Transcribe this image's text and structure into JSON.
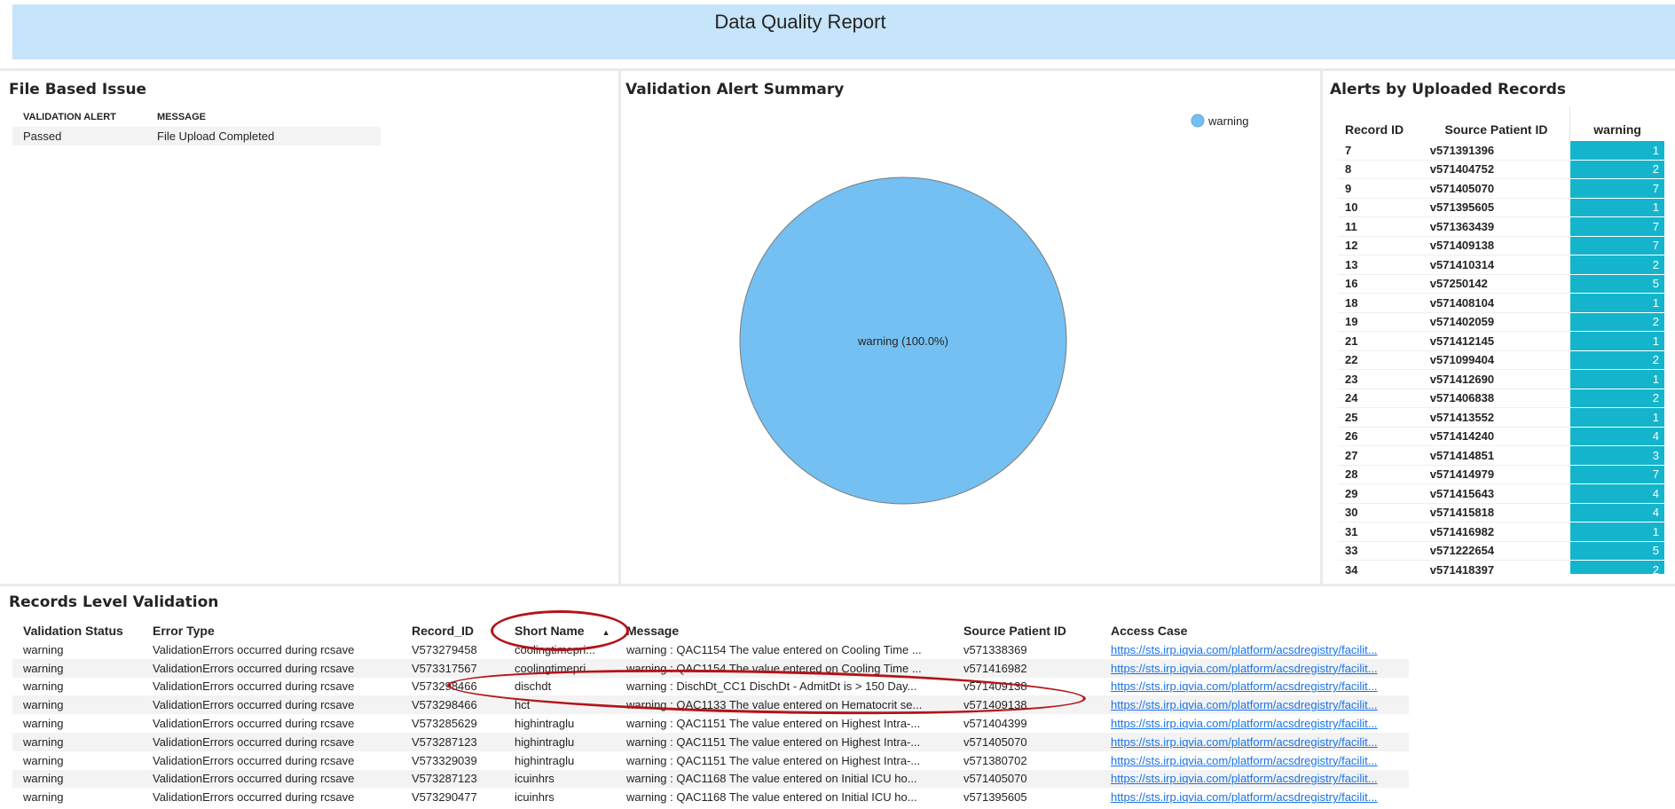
{
  "header": {
    "title": "Data Quality Report"
  },
  "file_based_issue": {
    "title": "File Based Issue",
    "columns": [
      "VALIDATION ALERT",
      "MESSAGE"
    ],
    "rows": [
      [
        "Passed",
        "File Upload Completed"
      ]
    ]
  },
  "validation_summary": {
    "title": "Validation Alert Summary",
    "legend_label": "warning",
    "slice_label": "warning (100.0%)",
    "color": "#74c0f2"
  },
  "chart_data": {
    "type": "pie",
    "title": "Validation Alert Summary",
    "series": [
      {
        "name": "warning",
        "value": 100.0
      }
    ],
    "legend_position": "top-right"
  },
  "alerts_by_records": {
    "title": "Alerts by Uploaded Records",
    "columns": [
      "Record ID",
      "Source Patient ID",
      "warning"
    ],
    "rows": [
      [
        "7",
        "v571391396",
        "1"
      ],
      [
        "8",
        "v571404752",
        "2"
      ],
      [
        "9",
        "v571405070",
        "7"
      ],
      [
        "10",
        "v571395605",
        "1"
      ],
      [
        "11",
        "v571363439",
        "7"
      ],
      [
        "12",
        "v571409138",
        "7"
      ],
      [
        "13",
        "v571410314",
        "2"
      ],
      [
        "16",
        "v57250142",
        "5"
      ],
      [
        "18",
        "v571408104",
        "1"
      ],
      [
        "19",
        "v571402059",
        "2"
      ],
      [
        "21",
        "v571412145",
        "1"
      ],
      [
        "22",
        "v571099404",
        "2"
      ],
      [
        "23",
        "v571412690",
        "1"
      ],
      [
        "24",
        "v571406838",
        "2"
      ],
      [
        "25",
        "v571413552",
        "1"
      ],
      [
        "26",
        "v571414240",
        "4"
      ],
      [
        "27",
        "v571414851",
        "3"
      ],
      [
        "28",
        "v571414979",
        "7"
      ],
      [
        "29",
        "v571415643",
        "4"
      ],
      [
        "30",
        "v571415818",
        "4"
      ],
      [
        "31",
        "v571416982",
        "1"
      ],
      [
        "33",
        "v571222654",
        "5"
      ],
      [
        "34",
        "v571418397",
        "2"
      ]
    ],
    "bar_color": "#14b5cc"
  },
  "records_level": {
    "title": "Records Level Validation",
    "columns": [
      "Validation Status",
      "Error Type",
      "Record_ID",
      "Short Name",
      "Message",
      "Source Patient ID",
      "Access Case"
    ],
    "sorted_column": "Short Name",
    "rows": [
      [
        "warning",
        "ValidationErrors occurred during rcsave",
        "V573279458",
        "coolingtimepri...",
        "warning : QAC1154 The value entered on Cooling Time ...",
        "v571338369",
        "https://sts.irp.iqvia.com/platform/acsdregistry/facilit..."
      ],
      [
        "warning",
        "ValidationErrors occurred during rcsave",
        "V573317567",
        "coolingtimepri...",
        "warning : QAC1154 The value entered on Cooling Time ...",
        "v571416982",
        "https://sts.irp.iqvia.com/platform/acsdregistry/facilit..."
      ],
      [
        "warning",
        "ValidationErrors occurred during rcsave",
        "V573298466",
        "dischdt",
        "warning : DischDt_CC1 DischDt - AdmitDt is > 150 Day...",
        "v571409138",
        "https://sts.irp.iqvia.com/platform/acsdregistry/facilit..."
      ],
      [
        "warning",
        "ValidationErrors occurred during rcsave",
        "V573298466",
        "hct",
        "warning : QAC1133 The value entered on Hematocrit se...",
        "v571409138",
        "https://sts.irp.iqvia.com/platform/acsdregistry/facilit..."
      ],
      [
        "warning",
        "ValidationErrors occurred during rcsave",
        "V573285629",
        "highintraglu",
        "warning : QAC1151 The value entered on Highest Intra-...",
        "v571404399",
        "https://sts.irp.iqvia.com/platform/acsdregistry/facilit..."
      ],
      [
        "warning",
        "ValidationErrors occurred during rcsave",
        "V573287123",
        "highintraglu",
        "warning : QAC1151 The value entered on Highest Intra-...",
        "v571405070",
        "https://sts.irp.iqvia.com/platform/acsdregistry/facilit..."
      ],
      [
        "warning",
        "ValidationErrors occurred during rcsave",
        "V573329039",
        "highintraglu",
        "warning : QAC1151 The value entered on Highest Intra-...",
        "v571380702",
        "https://sts.irp.iqvia.com/platform/acsdregistry/facilit..."
      ],
      [
        "warning",
        "ValidationErrors occurred during rcsave",
        "V573287123",
        "icuinhrs",
        "warning : QAC1168 The value entered on Initial ICU ho...",
        "v571405070",
        "https://sts.irp.iqvia.com/platform/acsdregistry/facilit..."
      ],
      [
        "warning",
        "ValidationErrors occurred during rcsave",
        "V573290477",
        "icuinhrs",
        "warning : QAC1168 The value entered on Initial ICU ho...",
        "v571395605",
        "https://sts.irp.iqvia.com/platform/acsdregistry/facilit..."
      ]
    ]
  }
}
